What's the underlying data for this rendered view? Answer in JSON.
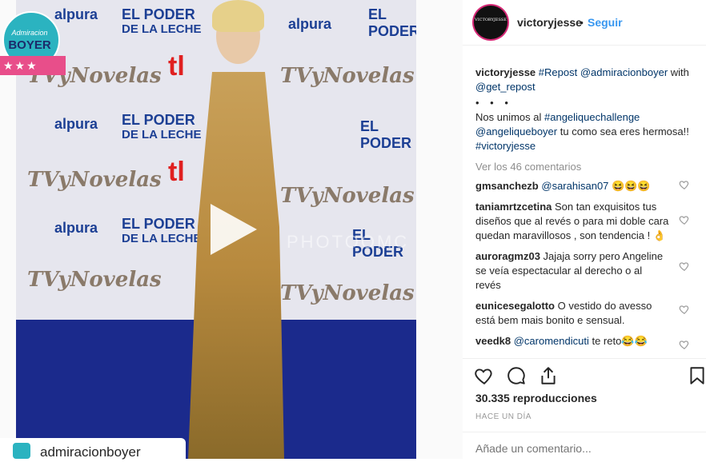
{
  "header": {
    "username": "victoryjesse",
    "separator": "•",
    "follow_label": "Seguir",
    "avatar_text": "VICTORYJESSE"
  },
  "media": {
    "badge": {
      "top": "Admiracion",
      "main": "BOYER",
      "ribbon": "★★★"
    },
    "brands": {
      "alpura": "alpura",
      "poder": "EL PODER",
      "leche": "DE LA LECHE",
      "tl": "tl",
      "tvnovelas": "TVyNovelas"
    },
    "watermark": "PHOTOOMC",
    "credit": "admiracionboyer",
    "play_icon": "play-icon"
  },
  "caption": {
    "user": "victoryjesse",
    "l1_tag": "#Repost",
    "l1_mention": "@admiracionboyer",
    "l2_with": "with",
    "l2_mention": "@get_repost",
    "dots": "• • •",
    "l3_text": "Nos unimos al",
    "l3_tag": "#angeliquechallenge",
    "l4_mention": "@angeliqueboyer",
    "l4_text": "tu como sea eres hermosa!!",
    "l4_tag": "#victoryjesse"
  },
  "view_all": "Ver los 46 comentarios",
  "comments": [
    {
      "user": "gmsanchezb",
      "mention": "@sarahisan07",
      "text": "😆😆😆"
    },
    {
      "user": "taniamrtzcetina",
      "text": "Son tan exquisitos tus diseños que al revés o para mi doble cara quedan maravillosos , son tendencia ! 👌"
    },
    {
      "user": "auroragmz03",
      "text": "Jajaja sorry pero Angeline se veía espectacular al derecho o al revés"
    },
    {
      "user": "eunicesegalotto",
      "text": "O vestido do avesso está bem mais bonito e sensual."
    },
    {
      "user": "veedk8",
      "mention": "@caromendicuti",
      "text": "te reto😂😂"
    }
  ],
  "views": "30.335 reproducciones",
  "time": "HACE UN DÍA",
  "add_comment_placeholder": "Añade un comentario...",
  "icons": [
    "heart-icon",
    "comment-icon",
    "share-icon",
    "bookmark-icon"
  ]
}
